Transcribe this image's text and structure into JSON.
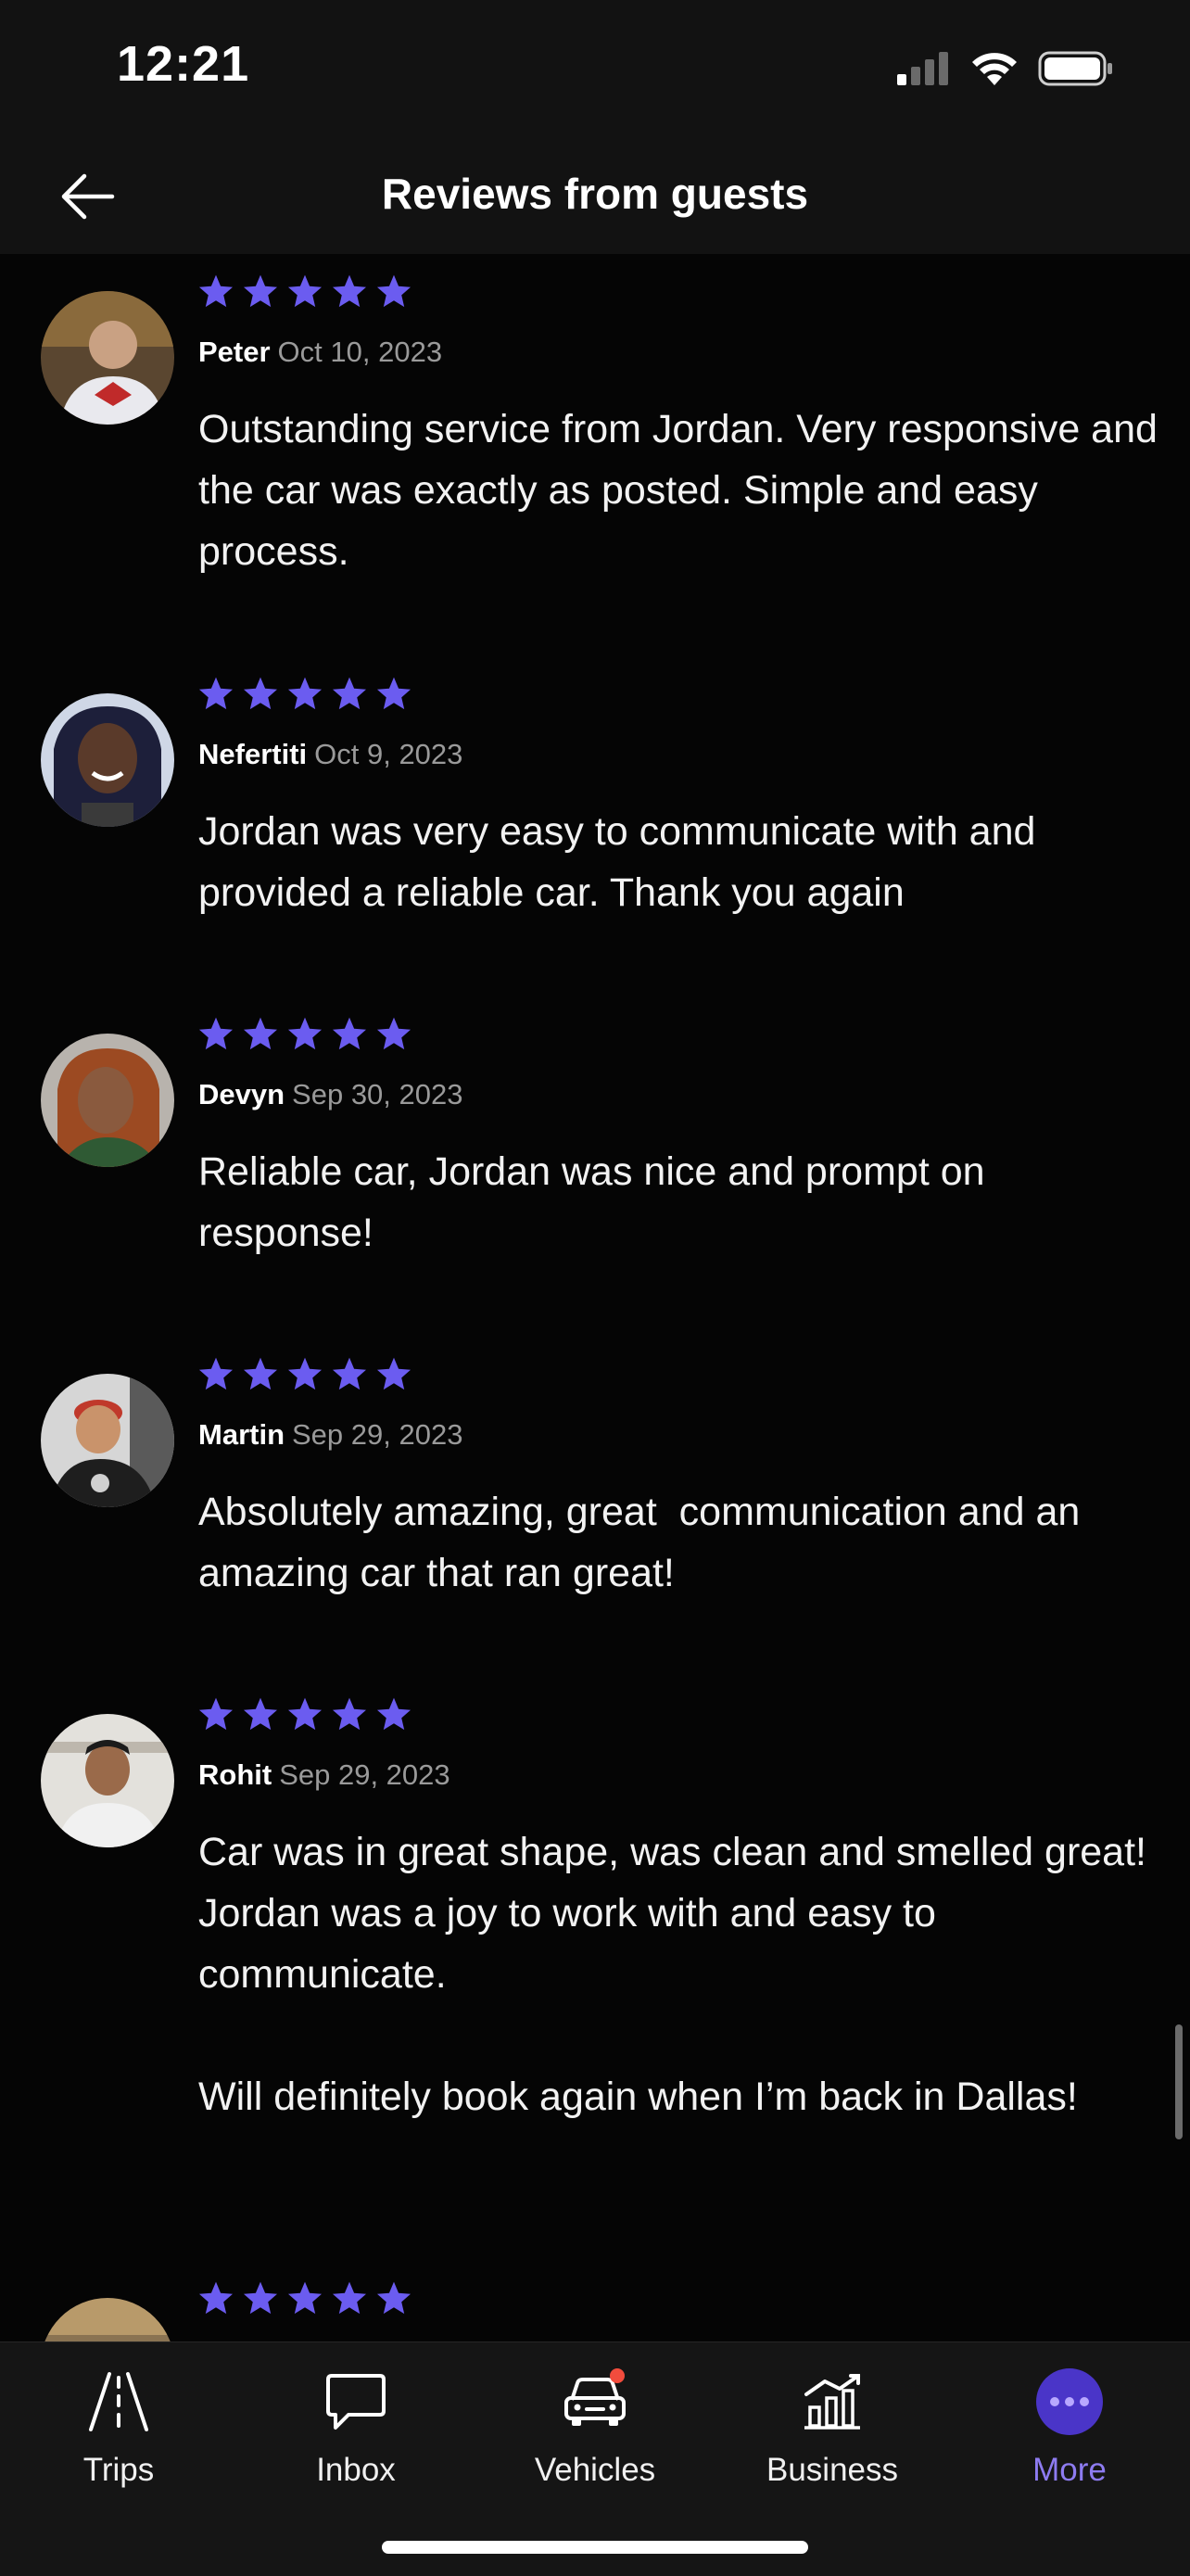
{
  "status": {
    "time": "12:21"
  },
  "header": {
    "title": "Reviews from guests"
  },
  "reviews": [
    {
      "name": "Peter",
      "date": "Oct 10, 2023",
      "rating": 5,
      "text": "Outstanding service from Jordan. Very responsive and the car was exactly as posted. Simple and easy process."
    },
    {
      "name": "Nefertiti",
      "date": "Oct 9, 2023",
      "rating": 5,
      "text": "Jordan was very easy to communicate with and provided a reliable car. Thank you again"
    },
    {
      "name": "Devyn",
      "date": "Sep 30, 2023",
      "rating": 5,
      "text": "Reliable car, Jordan was nice and prompt on response!"
    },
    {
      "name": "Martin",
      "date": "Sep 29, 2023",
      "rating": 5,
      "text": "Absolutely amazing, great  communication and an amazing car that ran great!"
    },
    {
      "name": "Rohit",
      "date": "Sep 29, 2023",
      "rating": 5,
      "text": "Car was in great shape, was clean and smelled great!\nJordan was a joy to work with and easy to communicate.\n\nWill definitely book again when I’m back in Dallas!"
    },
    {
      "rating": 5
    }
  ],
  "tabs": [
    {
      "label": "Trips",
      "icon": "road-icon"
    },
    {
      "label": "Inbox",
      "icon": "chat-bubble-icon"
    },
    {
      "label": "Vehicles",
      "icon": "car-icon",
      "has_badge": true
    },
    {
      "label": "Business",
      "icon": "bar-chart-icon"
    },
    {
      "label": "More",
      "icon": "more-dots-icon",
      "active": true
    }
  ],
  "colors": {
    "accent": "#6b5cf0",
    "star": "#6b5cf0",
    "badge": "#f24c3d",
    "active_label": "#8d7bf0"
  }
}
